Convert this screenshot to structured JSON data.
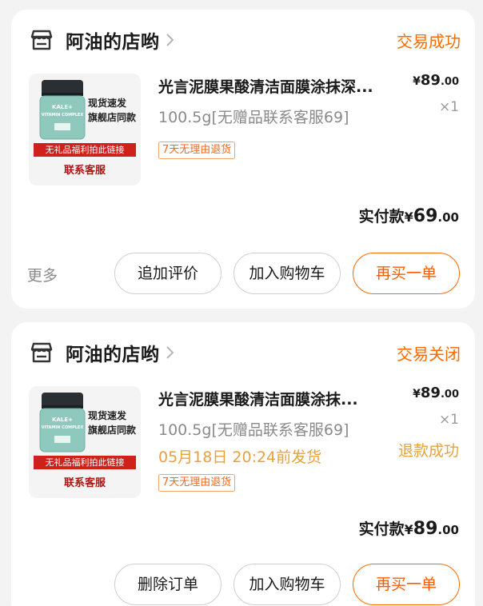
{
  "orders": [
    {
      "shop_name": "阿油的店哟",
      "status": "交易成功",
      "product": {
        "title": "光言泥膜果酸清洁面膜涂抹深...",
        "spec": "100.5g[无赠品联系客服69]",
        "service_tag": "7天无理由退货",
        "thumb_tag_1": "现货速发",
        "thumb_tag_2": "旗舰店同款",
        "thumb_bar": "无礼品福利拍此链接",
        "thumb_contact": "联系客服",
        "jar_label_1": "KALE+",
        "jar_label_2": "VITAMIN COMPLEX",
        "price_yen": "¥",
        "price_int": "89",
        "price_dec": ".00",
        "qty": "×1"
      },
      "total": {
        "label": "实付款",
        "yen": "¥",
        "int": "69",
        "dec": ".00"
      },
      "more_label": "更多",
      "buttons": [
        "追加评价",
        "加入购物车",
        "再买一单"
      ]
    },
    {
      "shop_name": "阿油的店哟",
      "status": "交易关闭",
      "product": {
        "title": "光言泥膜果酸清洁面膜涂抹...",
        "spec": "100.5g[无赠品联系客服69]",
        "ship_time": "05月18日 20:24前发货",
        "service_tag": "7天无理由退货",
        "thumb_tag_1": "现货速发",
        "thumb_tag_2": "旗舰店同款",
        "thumb_bar": "无礼品福利拍此链接",
        "thumb_contact": "联系客服",
        "jar_label_1": "KALE+",
        "jar_label_2": "VITAMIN COMPLEX",
        "price_yen": "¥",
        "price_int": "89",
        "price_dec": ".00",
        "qty": "×1",
        "refund_status": "退款成功"
      },
      "total": {
        "label": "实付款",
        "yen": "¥",
        "int": "89",
        "dec": ".00"
      },
      "buttons": [
        "删除订单",
        "加入购物车",
        "再买一单"
      ]
    }
  ],
  "icons": {
    "shop": "shop-icon",
    "chevron": "chevron-right-icon",
    "jar": "jar-icon"
  },
  "colors": {
    "accent": "#ff6a00",
    "warning": "#e8a23b",
    "muted": "#8a8a8a",
    "promo_red": "#d0201a"
  }
}
